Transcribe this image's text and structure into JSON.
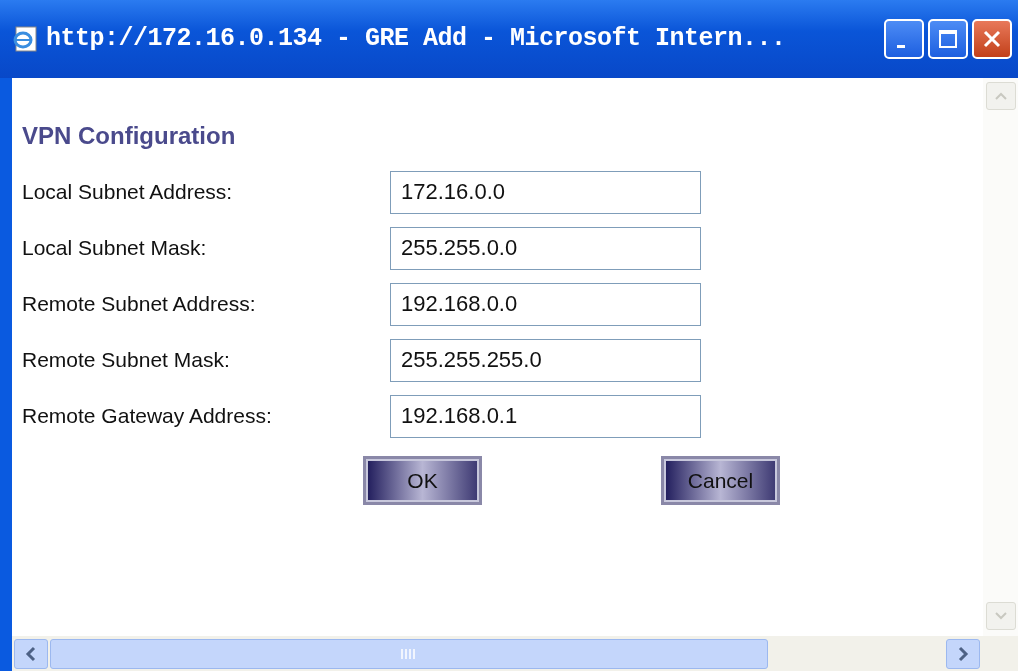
{
  "window": {
    "title": "http://172.16.0.134 - GRE Add - Microsoft Intern..."
  },
  "heading": "VPN Configuration",
  "fields": [
    {
      "label": "Local Subnet Address:",
      "value": "172.16.0.0"
    },
    {
      "label": "Local Subnet Mask:",
      "value": "255.255.0.0"
    },
    {
      "label": "Remote Subnet Address:",
      "value": "192.168.0.0"
    },
    {
      "label": "Remote Subnet Mask:",
      "value": "255.255.255.0"
    },
    {
      "label": "Remote Gateway Address:",
      "value": "192.168.0.1"
    }
  ],
  "buttons": [
    {
      "label": "OK"
    },
    {
      "label": "Cancel"
    }
  ]
}
